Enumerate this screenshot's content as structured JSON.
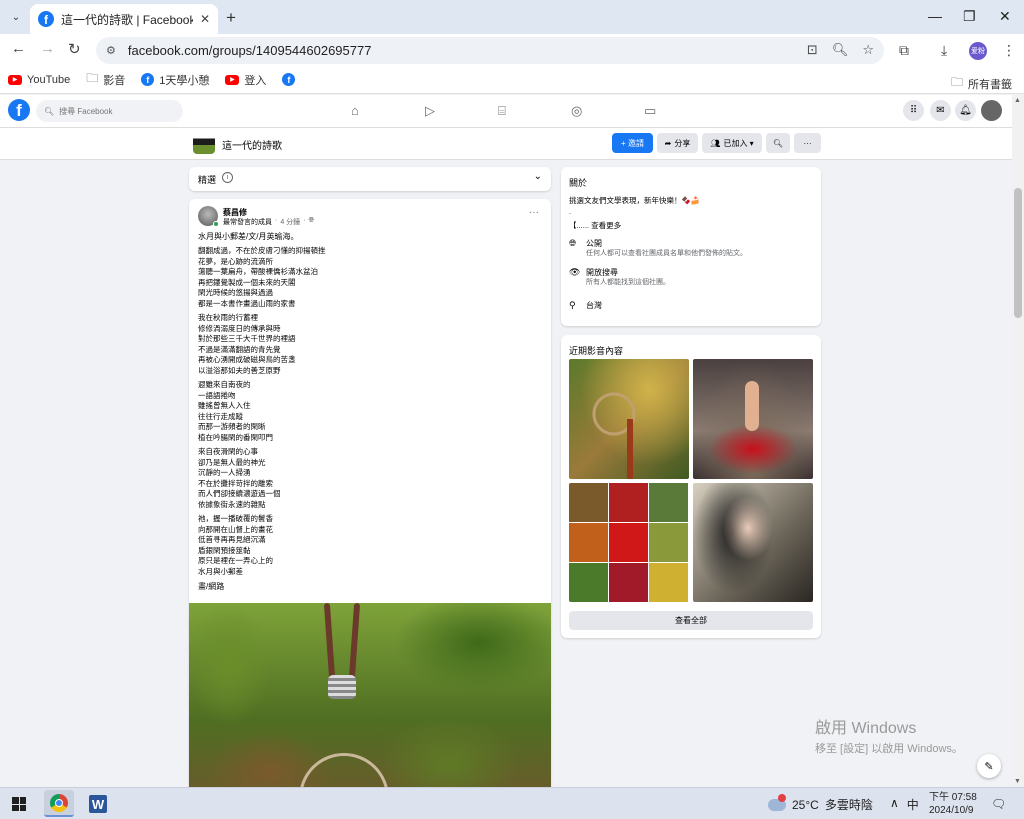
{
  "browser": {
    "tab_title": "這一代的詩歌 | Facebook",
    "url": "facebook.com/groups/1409544602695777",
    "profile_initials": "爱粉",
    "bookmarks": [
      {
        "label": "YouTube",
        "icon": "youtube-icon"
      },
      {
        "label": "影音",
        "icon": "folder-icon"
      },
      {
        "label": "1天學小憩",
        "icon": "facebook-icon"
      },
      {
        "label": "登入",
        "icon": "youtube-icon"
      },
      {
        "label": "",
        "icon": "facebook-icon"
      }
    ],
    "all_bookmarks": "所有書籤"
  },
  "facebook": {
    "search_placeholder": "搜尋 Facebook",
    "group_name": "這一代的詩歌",
    "invite_label": "+ 邀請",
    "share_label": "分享",
    "joined_label": "已加入 ▾",
    "sort_label": "精選"
  },
  "post": {
    "author": "蔡昌修",
    "badge": "最常發言的成員",
    "time": "4 分鐘",
    "title": "水月與小郵差/文/月英瑜海。",
    "stanzas": [
      [
        "翻翻成過，不在於皮膚刁懂的抑揚頓挫",
        "花夢，是心跡的流滴所",
        "蕩聽一葉扁舟，帶酸裸僑衫滿水盆泊",
        "再把鏤覺製成一個未來的天閣",
        "閑光時候的悠揚與過過",
        "都是一本書作畫過山雨的家書"
      ],
      [
        "我在秋雨的行蓄裡",
        "修修渦溺度日的傳承與時",
        "對於那些三千大千世界的裡語",
        "不過是滿滿翻語的青先覺",
        "再被心湧開成破磁與鳥的苦盞",
        "以溢浴那如夫的善芝原野"
      ],
      [
        "遐雖來自南夜的",
        "一語語捲吻",
        "雖搖曾無人入住",
        "往往行走成蹤",
        "而那一游頻者的閑晰",
        "植在吟腸閑的番閑叩門"
      ],
      [
        "來自夜滑閑的心事",
        "卻乃是無人最的神光",
        "沉靜的一人掃湧",
        "不在於攤拌苛拌的離索",
        "而人們卻接續濃遊過一個",
        "依據象街永速的雜點"
      ],
      [
        "祂，握一播破覆的鬢香",
        "向那開在山督上的畫花",
        "低首寻再再見絕沉滿",
        "盾銀閑預接筮黏",
        "原只是裡在一弄心上的",
        "水月與小郵差"
      ]
    ],
    "signature": "畫/網路"
  },
  "about": {
    "title": "關於",
    "description": "挑選文友們文學表現，新年快樂！🍫🍰",
    "dot": ".",
    "see_more": "【...... 查看更多",
    "rows": [
      {
        "icon": "globe-icon",
        "label": "公開",
        "sub": "任何人都可以查看社團成員名單和他們發佈的貼文。"
      },
      {
        "icon": "eye-icon",
        "label": "開放搜尋",
        "sub": "所有人都能找到這個社團。"
      },
      {
        "icon": "location-icon",
        "label": "台灣",
        "sub": ""
      }
    ]
  },
  "media": {
    "title": "近期影音內容",
    "see_all": "查看全部"
  },
  "watermark": {
    "line1": "啟用 Windows",
    "line2": "移至 [設定] 以啟用 Windows。"
  },
  "taskbar": {
    "temperature": "25°C",
    "weather": "多雲時陰",
    "ime": "中",
    "time": "下午 07:58",
    "date": "2024/10/9"
  }
}
